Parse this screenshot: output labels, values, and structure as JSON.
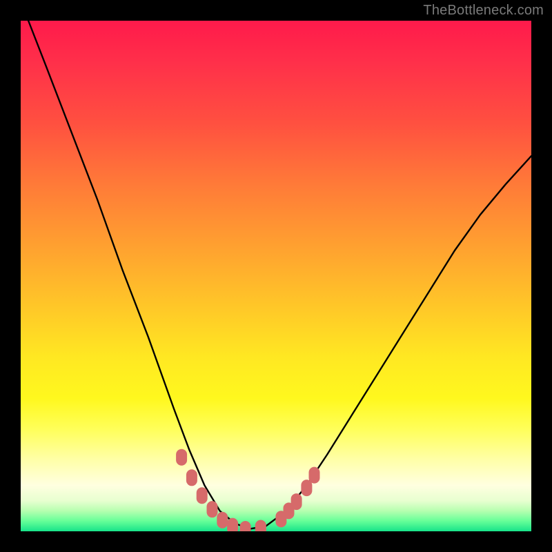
{
  "watermark": "TheBottleneck.com",
  "chart_data": {
    "type": "line",
    "title": "",
    "xlabel": "",
    "ylabel": "",
    "xlim": [
      0,
      1
    ],
    "ylim": [
      0,
      1
    ],
    "grid": false,
    "legend": false,
    "annotations": [],
    "series": [
      {
        "name": "bottleneck-curve",
        "color": "#000000",
        "x": [
          0.015,
          0.05,
          0.1,
          0.15,
          0.2,
          0.25,
          0.3,
          0.33,
          0.36,
          0.39,
          0.42,
          0.45,
          0.48,
          0.52,
          0.56,
          0.6,
          0.65,
          0.7,
          0.75,
          0.8,
          0.85,
          0.9,
          0.95,
          1.0
        ],
        "y": [
          1.0,
          0.91,
          0.78,
          0.65,
          0.51,
          0.38,
          0.24,
          0.16,
          0.09,
          0.04,
          0.015,
          0.005,
          0.01,
          0.04,
          0.09,
          0.15,
          0.23,
          0.31,
          0.39,
          0.47,
          0.55,
          0.62,
          0.68,
          0.735
        ]
      }
    ],
    "markers": [
      {
        "name": "dip-dot-cluster",
        "color": "#d66a6a",
        "shape": "rounded-capsule",
        "points": [
          {
            "x": 0.315,
            "y": 0.145
          },
          {
            "x": 0.335,
            "y": 0.105
          },
          {
            "x": 0.355,
            "y": 0.07
          },
          {
            "x": 0.375,
            "y": 0.043
          },
          {
            "x": 0.395,
            "y": 0.022
          },
          {
            "x": 0.415,
            "y": 0.01
          },
          {
            "x": 0.44,
            "y": 0.004
          },
          {
            "x": 0.47,
            "y": 0.006
          },
          {
            "x": 0.51,
            "y": 0.024
          },
          {
            "x": 0.525,
            "y": 0.04
          },
          {
            "x": 0.54,
            "y": 0.058
          },
          {
            "x": 0.56,
            "y": 0.085
          },
          {
            "x": 0.575,
            "y": 0.11
          }
        ]
      }
    ],
    "background_gradient_stops": [
      {
        "pos": 0.0,
        "color": "#ff1a4b"
      },
      {
        "pos": 0.2,
        "color": "#ff5040"
      },
      {
        "pos": 0.44,
        "color": "#ffa030"
      },
      {
        "pos": 0.66,
        "color": "#ffe822"
      },
      {
        "pos": 0.86,
        "color": "#ffffa8"
      },
      {
        "pos": 0.96,
        "color": "#b6ffb0"
      },
      {
        "pos": 1.0,
        "color": "#17e38a"
      }
    ]
  }
}
